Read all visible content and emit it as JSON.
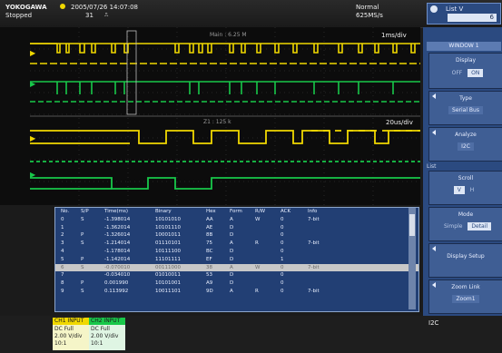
{
  "header": {
    "brand": "YOKOGAWA",
    "status": "Stopped",
    "datetime": "2005/07/26 14:07:08",
    "count": "31",
    "mode": "Normal",
    "sample_rate": "625MS/s",
    "menu_name": "List V",
    "menu_value": "6"
  },
  "scope": {
    "main_label": "Main : 6.25 M",
    "main_timebase": "1ms/div",
    "zoom_label": "Z1 : 125 k",
    "zoom_timebase": "20us/div"
  },
  "table": {
    "headers": [
      "No.",
      "S/P",
      "Time(ms)",
      "Binary",
      "Hex",
      "Form",
      "R/W",
      "ACK",
      "Info"
    ],
    "rows": [
      {
        "no": "0",
        "sp": "S",
        "time": "-1.398014",
        "bin": "10101010",
        "hex": "AA",
        "form": "A",
        "rw": "W",
        "ack": "0",
        "info": "7-bit"
      },
      {
        "no": "1",
        "sp": "",
        "time": "-1.362014",
        "bin": "10101110",
        "hex": "AE",
        "form": "D",
        "rw": "",
        "ack": "0",
        "info": ""
      },
      {
        "no": "2",
        "sp": "P",
        "time": "-1.326014",
        "bin": "10001011",
        "hex": "8B",
        "form": "D",
        "rw": "",
        "ack": "0",
        "info": ""
      },
      {
        "no": "3",
        "sp": "S",
        "time": "-1.214014",
        "bin": "01110101",
        "hex": "75",
        "form": "A",
        "rw": "R",
        "ack": "0",
        "info": "7-bit"
      },
      {
        "no": "4",
        "sp": "",
        "time": "-1.178014",
        "bin": "10111100",
        "hex": "BC",
        "form": "D",
        "rw": "",
        "ack": "0",
        "info": ""
      },
      {
        "no": "5",
        "sp": "P",
        "time": "-1.142014",
        "bin": "11101111",
        "hex": "EF",
        "form": "D",
        "rw": "",
        "ack": "1",
        "info": ""
      },
      {
        "no": "6",
        "sp": "S",
        "time": "-0.070010",
        "bin": "00111000",
        "hex": "38",
        "form": "A",
        "rw": "W",
        "ack": "0",
        "info": "7-bit",
        "selected": true
      },
      {
        "no": "7",
        "sp": "",
        "time": "-0.034010",
        "bin": "01010011",
        "hex": "53",
        "form": "D",
        "rw": "",
        "ack": "0",
        "info": ""
      },
      {
        "no": "8",
        "sp": "P",
        "time": "0.001990",
        "bin": "10101001",
        "hex": "A9",
        "form": "D",
        "rw": "",
        "ack": "0",
        "info": ""
      },
      {
        "no": "9",
        "sp": "S",
        "time": "0.113992",
        "bin": "10011101",
        "hex": "9D",
        "form": "A",
        "rw": "R",
        "ack": "0",
        "info": "7-bit"
      }
    ]
  },
  "right_panel": {
    "window_title": "WINDOW 1",
    "display_label": "Display",
    "display_off": "OFF",
    "display_on": "ON",
    "type_label": "Type",
    "type_value": "Serial Bus",
    "analyze_label": "Analyze",
    "analyze_value": "I2C",
    "list_title": "List",
    "scroll_label": "Scroll",
    "scroll_v": "V",
    "scroll_h": "H",
    "mode_label": "Mode",
    "mode_simple": "Simple",
    "mode_detail": "Detail",
    "display_setup": "Display Setup",
    "zoom_link_label": "Zoom Link",
    "zoom_link_value": "Zoom1"
  },
  "bottom": {
    "ch1_title": "CH1 INPUT",
    "ch1_coupling": "DC Full",
    "ch1_scale": "2.00 V/div",
    "ch1_probe": "10:1",
    "ch2_title": "CH2 INPUT",
    "ch2_coupling": "DC Full",
    "ch2_scale": "2.00 V/div",
    "ch2_probe": "10:1",
    "i2c_label": "I2C"
  },
  "colors": {
    "ch1": "#f0d800",
    "ch2": "#18c84a",
    "panel_blue": "#2b4a80",
    "table_blue": "#223f74"
  }
}
